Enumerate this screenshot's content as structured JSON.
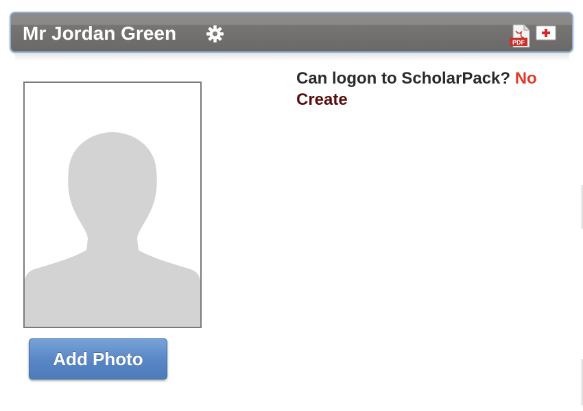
{
  "header": {
    "title": "Mr Jordan Green",
    "icons": [
      "gear-icon",
      "pdf-icon",
      "medical-icon"
    ],
    "pdf_icon_label": "PDF"
  },
  "photo": {
    "placeholder": "silhouette-placeholder",
    "add_button_label": "Add Photo"
  },
  "logon": {
    "question": "Can logon to ScholarPack?",
    "value": "No",
    "create_label": "Create"
  },
  "colors": {
    "header_bg": "#7a7777",
    "header_border": "#8fb0d8",
    "button_bg": "#5a88c6",
    "no_value": "#e03a28",
    "create_link": "#5a0d0d",
    "silhouette": "#d3d3d3"
  }
}
